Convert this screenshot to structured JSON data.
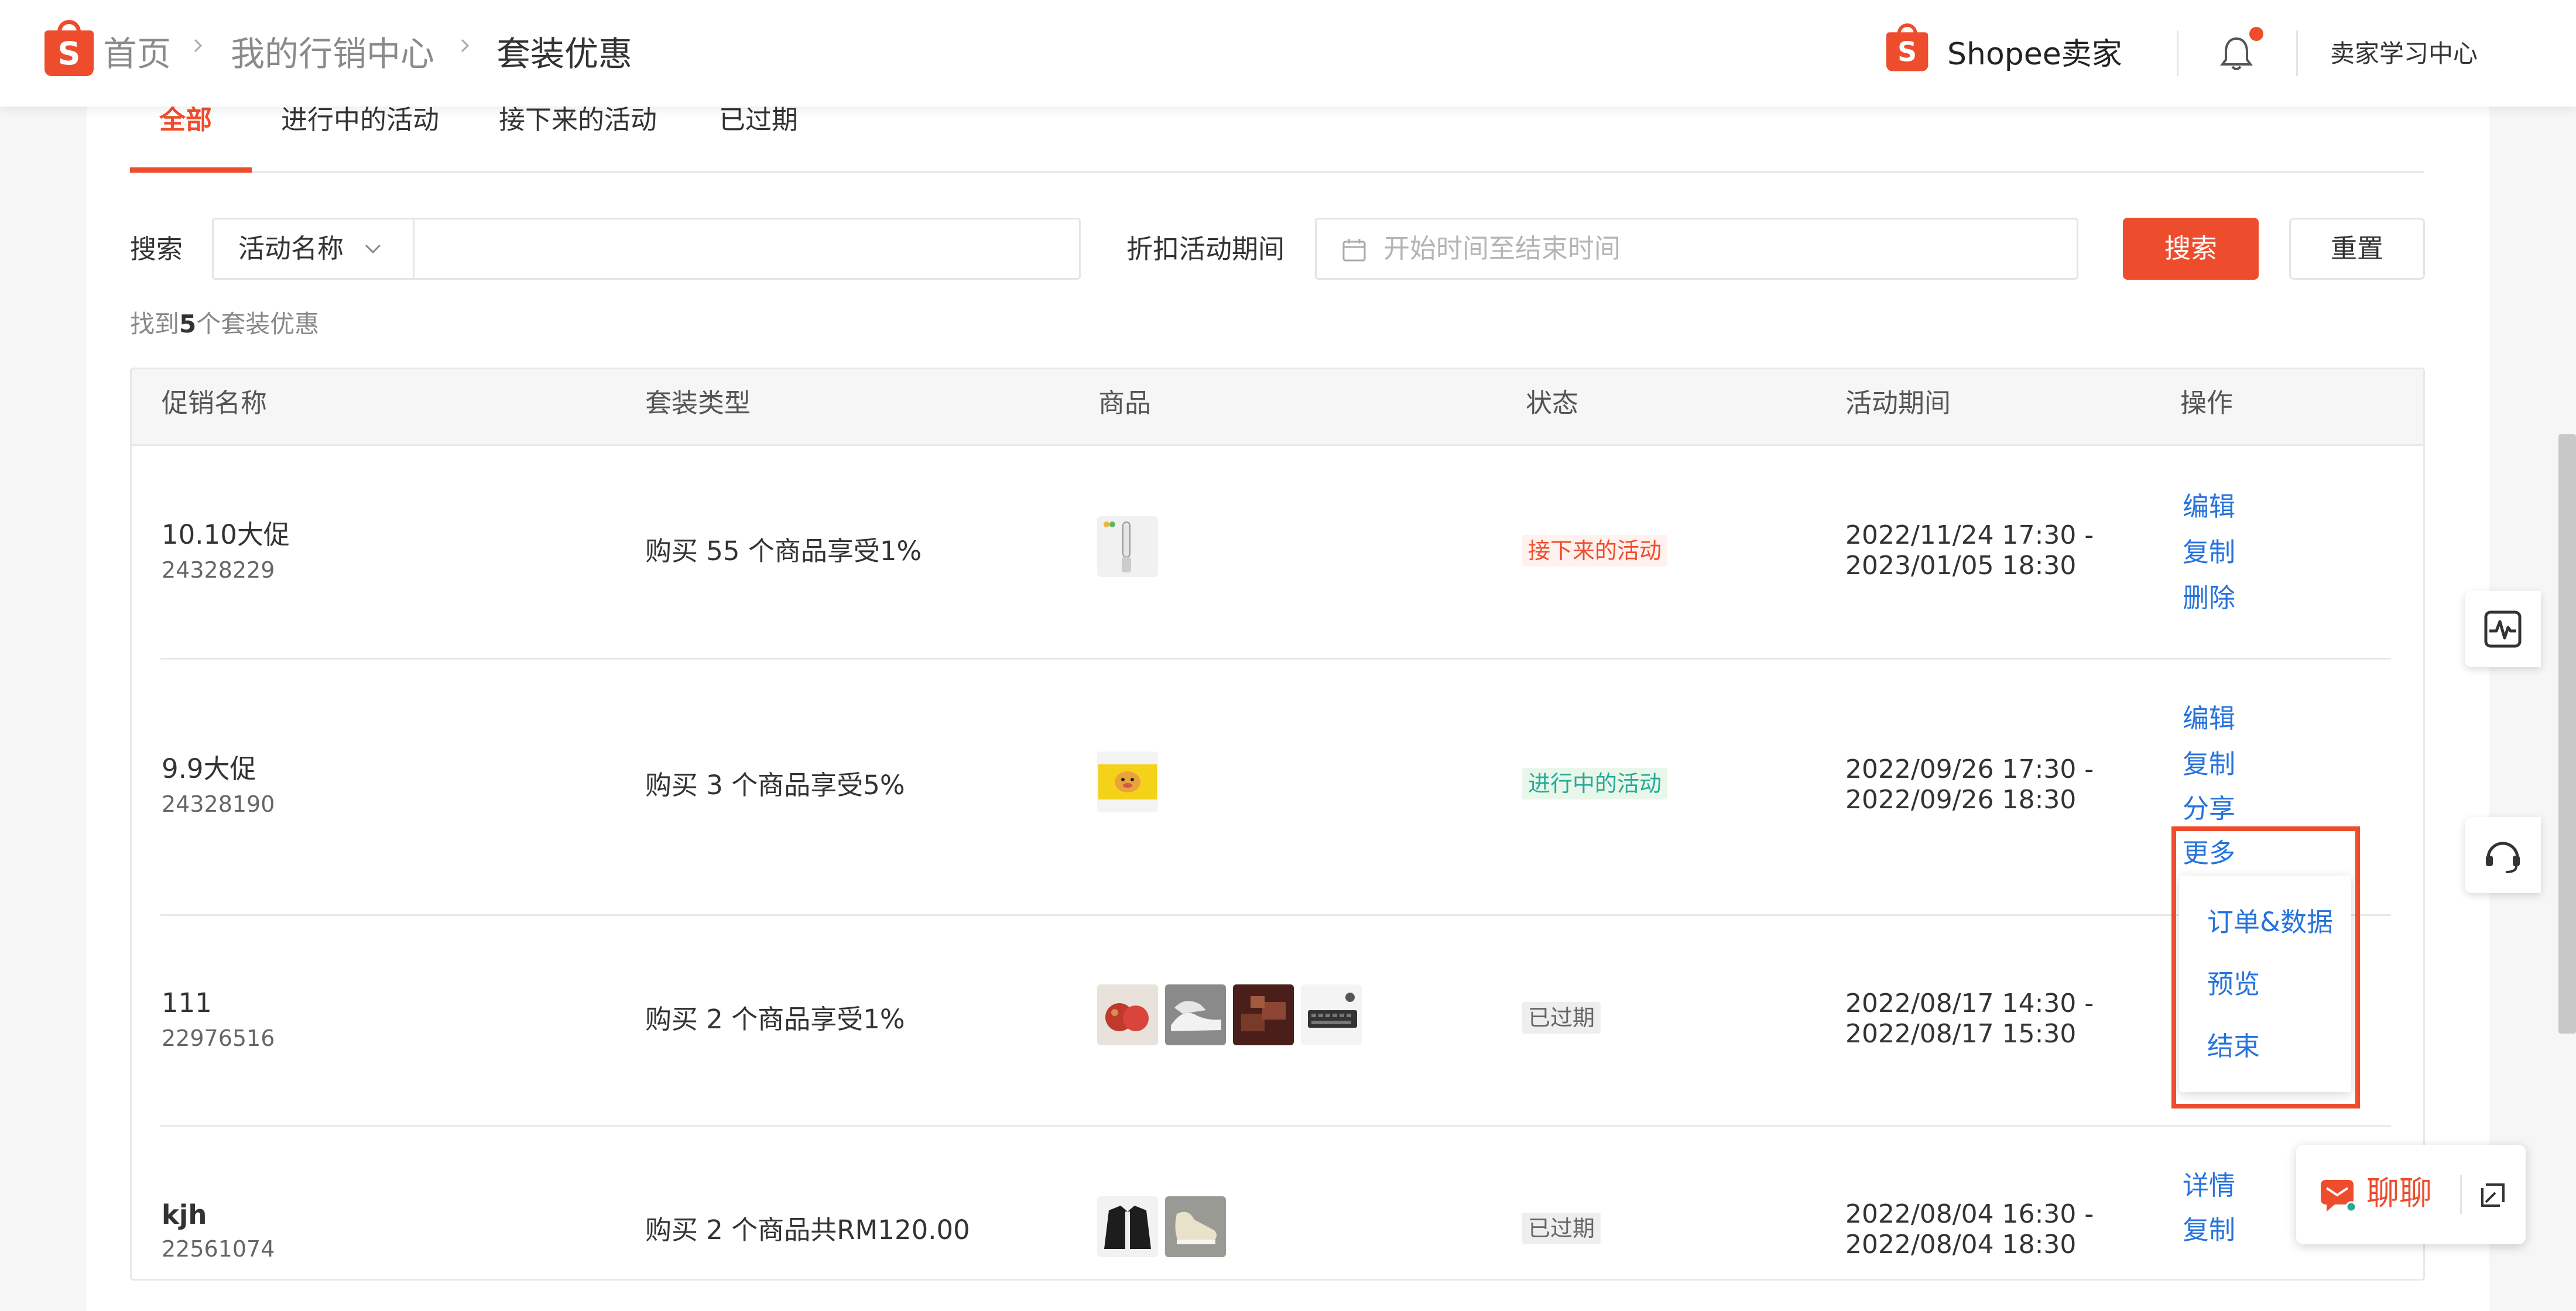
{
  "header": {
    "breadcrumbs": [
      "首页",
      "我的行销中心",
      "套装优惠"
    ],
    "brand_logo_letter": "S",
    "brand_name": "Shopee卖家",
    "learning_center": "卖家学习中心",
    "has_notification": true
  },
  "tabs": [
    {
      "label": "全部",
      "active": true
    },
    {
      "label": "进行中的活动",
      "active": false
    },
    {
      "label": "接下来的活动",
      "active": false
    },
    {
      "label": "已过期",
      "active": false
    }
  ],
  "filters": {
    "search_label": "搜索",
    "search_field_type": "活动名称",
    "search_value": "",
    "period_label": "折扣活动期间",
    "period_placeholder": "开始时间至结束时间",
    "search_button": "搜索",
    "reset_button": "重置"
  },
  "result_summary": {
    "prefix": "找到",
    "count": "5",
    "suffix": "个套装优惠"
  },
  "table": {
    "columns": [
      "促销名称",
      "套装类型",
      "商品",
      "状态",
      "活动期间",
      "操作"
    ],
    "rows": [
      {
        "name": "10.10大促",
        "id": "24328229",
        "type": "购买 55 个商品享受1%",
        "products": [
          "toothbrush-product"
        ],
        "status": "接下来的活动",
        "status_kind": "upcoming",
        "period_start": "2022/11/24 17:30 -",
        "period_end": "2023/01/05 18:30",
        "actions": [
          "编辑",
          "复制",
          "删除"
        ]
      },
      {
        "name": "9.9大促",
        "id": "24328190",
        "type": "购买 3 个商品享受5%",
        "products": [
          "yellow-case-product"
        ],
        "status": "进行中的活动",
        "status_kind": "ongoing",
        "period_start": "2022/09/26 17:30 -",
        "period_end": "2022/09/26 18:30",
        "actions": [
          "编辑",
          "复制",
          "分享",
          "更多"
        ]
      },
      {
        "name": "111",
        "id": "22976516",
        "type": "购买 2 个商品享受1%",
        "products": [
          "apple-product",
          "sneaker-product",
          "chocolate-product",
          "keyboard-product"
        ],
        "status": "已过期",
        "status_kind": "expired",
        "period_start": "2022/08/17 14:30 -",
        "period_end": "2022/08/17 15:30",
        "actions": []
      },
      {
        "name": "kjh",
        "id": "22561074",
        "type": "购买 2 个商品共RM120.00",
        "products": [
          "jacket-product",
          "canvas-shoe-product"
        ],
        "status": "已过期",
        "status_kind": "expired",
        "period_start": "2022/08/04 16:30 -",
        "period_end": "2022/08/04 18:30",
        "actions": [
          "详情",
          "复制"
        ]
      }
    ]
  },
  "more_menu": {
    "options": [
      "订单&数据",
      "预览",
      "结束"
    ]
  },
  "chat": {
    "label": "聊聊"
  },
  "colors": {
    "brand": "#ee4d2d",
    "link": "#2673dd",
    "upcoming_text": "#ee4d2d",
    "upcoming_bg": "#fff1ee",
    "ongoing_text": "#26aa99",
    "ongoing_bg": "#e8f7ea",
    "expired_text": "#666666",
    "expired_bg": "#eeeeee"
  }
}
